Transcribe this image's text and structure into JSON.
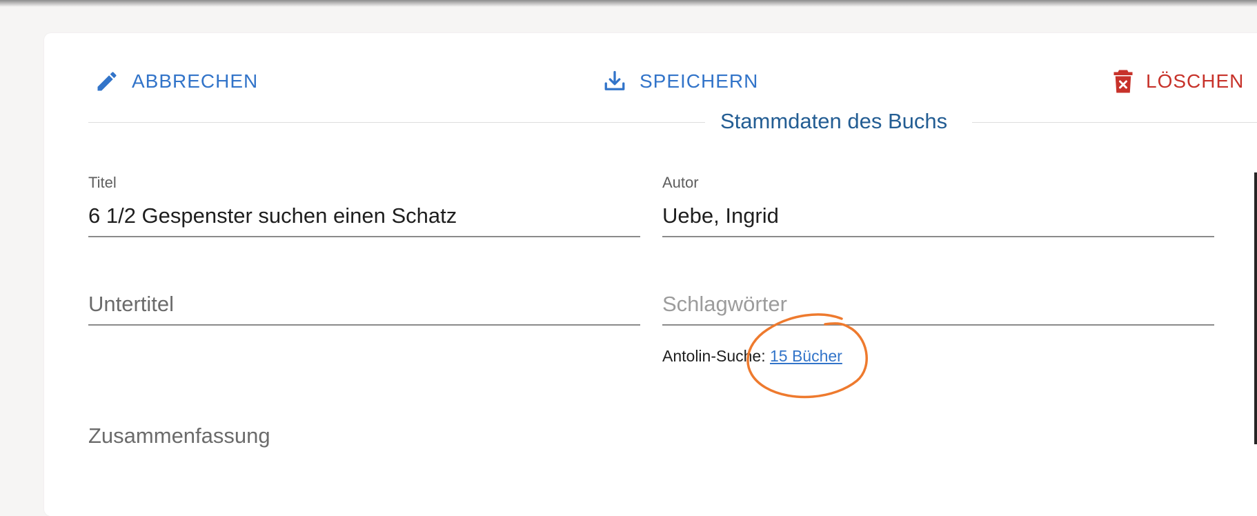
{
  "toolbar": {
    "cancel_label": "ABBRECHEN",
    "save_label": "SPEICHERN",
    "delete_label": "LÖSCHEN"
  },
  "section": {
    "title": "Stammdaten des Buchs"
  },
  "fields": {
    "titel": {
      "label": "Titel",
      "value": "6 1/2 Gespenster suchen einen Schatz"
    },
    "autor": {
      "label": "Autor",
      "value": "Uebe, Ingrid"
    },
    "untertitel": {
      "placeholder": "Untertitel",
      "value": ""
    },
    "schlagwoerter": {
      "placeholder": "Schlagwörter",
      "value": ""
    },
    "zusammenfassung": {
      "placeholder": "Zusammenfassung",
      "value": ""
    }
  },
  "antolin": {
    "label": "Antolin-Suche:",
    "link_text": "15 Bücher"
  },
  "colors": {
    "accent_blue": "#3274c9",
    "delete_red": "#c7322a",
    "section_title": "#235d93",
    "annotation_orange": "#ee7a2e"
  },
  "icons": {
    "cancel": "pencil-icon",
    "save": "download-icon",
    "delete": "trash-icon"
  }
}
